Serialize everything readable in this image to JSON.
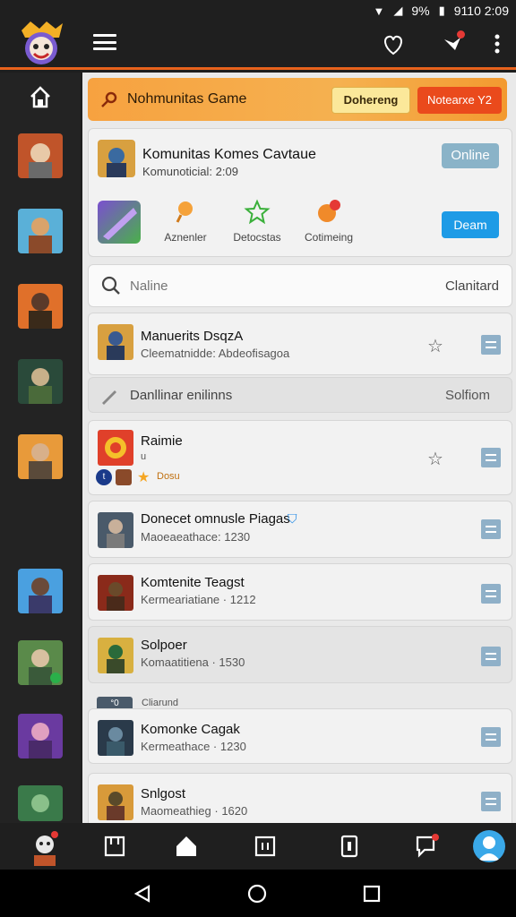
{
  "status_bar": {
    "battery": "9%",
    "time": "9110 2:09"
  },
  "banner": {
    "title": "Nohmunitas Game",
    "button1": "Dohereng",
    "button2": "Notearxe Y2"
  },
  "profile": {
    "title": "Komunitas Komes Cavtaue",
    "subtitle": "Komunoticial: 2:09",
    "online_label": "Online",
    "actions": [
      {
        "label": "Aznenler"
      },
      {
        "label": "Detocstas"
      },
      {
        "label": "Cotimeing"
      }
    ],
    "start_label": "Deam"
  },
  "search": {
    "placeholder": "Naline",
    "right_label": "Clanitard"
  },
  "edit_row": {
    "label": "Danllinar enilinns",
    "right_label": "Solfiom"
  },
  "section_chip": {
    "icon_label": "ᐤ0",
    "label": "Cliarund"
  },
  "list": [
    {
      "title": "Manuerits DsqzA",
      "subtitle": "Cleematnidde: Abdeofisagoa"
    },
    {
      "title": "Raimie",
      "subtitle": "u",
      "badge": "Dosu"
    },
    {
      "title": "Donecet omnusle Piagas",
      "subtitle": "Maoeaeathace: 1230"
    },
    {
      "title": "Komtenite Teagst",
      "subtitle": "Kermeariatiane · 1212"
    },
    {
      "title": "Solpoer",
      "subtitle": "Komaatitiena · 1530"
    },
    {
      "title": "Komonke Cagak",
      "subtitle": "Kermeathace · 1230"
    },
    {
      "title": "Snlgost",
      "subtitle": "Maomeathieg · 1620"
    }
  ],
  "colors": {
    "accent": "#e8621c",
    "banner": "#f5a847",
    "cta_blue": "#1e9be6",
    "online": "#8ab3c8"
  }
}
